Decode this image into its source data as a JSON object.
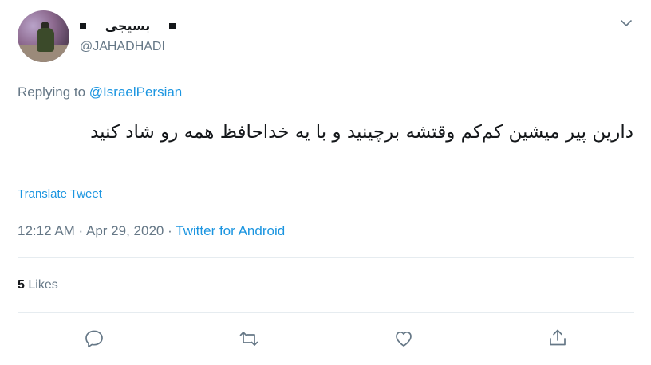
{
  "author": {
    "display_name": "بسیجی",
    "handle": "@JAHADHADI"
  },
  "reply": {
    "prefix": "Replying to",
    "to": "@IsraelPersian"
  },
  "tweet": {
    "text": "دارین پیر میشین کم‌کم وقتشه برچینید و با یه خداحافظ همه رو شاد کنید",
    "translate_label": "Translate Tweet",
    "time": "12:12 AM",
    "separator1": " · ",
    "date": "Apr 29, 2020",
    "separator2": " · ",
    "source": "Twitter for Android"
  },
  "stats": {
    "likes_count": "5",
    "likes_label": "Likes"
  },
  "icons": {
    "reply": "reply-icon",
    "retweet": "retweet-icon",
    "like": "heart-icon",
    "share": "share-icon",
    "menu": "chevron-down-icon"
  },
  "colors": {
    "accent": "#1b95e0",
    "muted": "#657786",
    "text": "#14171a",
    "divider": "#e6ecf0"
  }
}
